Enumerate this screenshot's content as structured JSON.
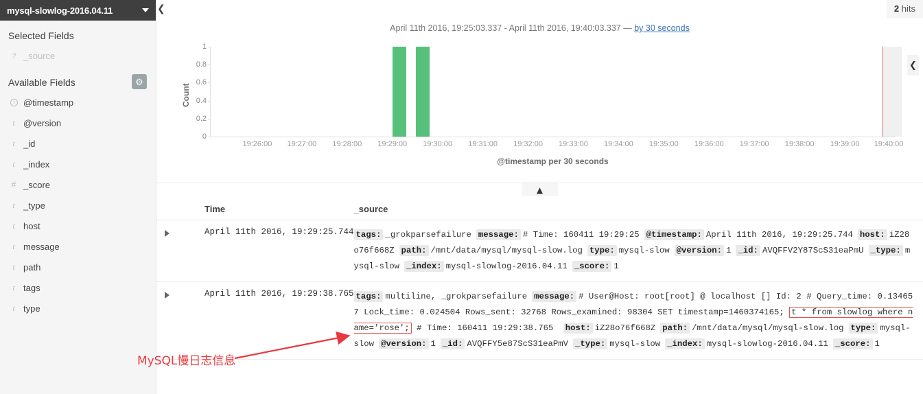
{
  "sidebar": {
    "index_pattern": "mysql-slowlog-2016.04.11",
    "caret_icon": "caret-down-icon",
    "collapse_icon": "chevron-left-icon",
    "gear_icon": "gear-icon",
    "selected_fields_title": "Selected Fields",
    "selected_fields": [
      {
        "type": "?",
        "name": "_source"
      }
    ],
    "available_fields_title": "Available Fields",
    "available_fields": [
      {
        "type": "clock",
        "name": "@timestamp"
      },
      {
        "type": "t",
        "name": "@version"
      },
      {
        "type": "t",
        "name": "_id"
      },
      {
        "type": "t",
        "name": "_index"
      },
      {
        "type": "#",
        "name": "_score"
      },
      {
        "type": "t",
        "name": "_type"
      },
      {
        "type": "t",
        "name": "host"
      },
      {
        "type": "t",
        "name": "message"
      },
      {
        "type": "t",
        "name": "path"
      },
      {
        "type": "t",
        "name": "tags"
      },
      {
        "type": "t",
        "name": "type"
      }
    ]
  },
  "header": {
    "hits_count": "2",
    "hits_label": "hits"
  },
  "chart_data": {
    "type": "bar",
    "title": "April 11th 2016, 19:25:03.337 - April 11th 2016, 19:40:03.337 — ",
    "interval_link": "by 30 seconds",
    "range_start": "April 11th 2016, 19:25:03.337",
    "range_end": "April 11th 2016, 19:40:03.337",
    "xlabel": "@timestamp per 30 seconds",
    "ylabel": "Count",
    "ylim": [
      0,
      1
    ],
    "yticks": [
      "0",
      "0.2",
      "0.4",
      "0.6",
      "0.8",
      "1"
    ],
    "xticks": [
      "19:26:00",
      "19:27:00",
      "19:28:00",
      "19:29:00",
      "19:30:00",
      "19:31:00",
      "19:32:00",
      "19:33:00",
      "19:34:00",
      "19:35:00",
      "19:36:00",
      "19:37:00",
      "19:38:00",
      "19:39:00",
      "19:40:00"
    ],
    "categories": [
      "19:29:00",
      "19:29:30"
    ],
    "values": [
      1,
      1
    ],
    "bar_color": "#57c17b",
    "grid": false,
    "legend": "none",
    "now_marker": "19:40:00",
    "collapse_icon": "chevron-left-icon"
  },
  "table": {
    "collapse_icon": "chevron-up-icon",
    "columns": [
      "Time",
      "_source"
    ],
    "expand_icon": "triangle-right-icon",
    "rows": [
      {
        "time": "April 11th 2016, 19:29:25.744",
        "fields": [
          {
            "key": "tags:",
            "value": "_grokparsefailure"
          },
          {
            "key": "message:",
            "value": "# Time: 160411 19:29:25"
          },
          {
            "key": "@timestamp:",
            "value": "April 11th 2016, 19:29:25.744"
          },
          {
            "key": "host:",
            "value": "iZ28o76f668Z"
          },
          {
            "key": "path:",
            "value": "/mnt/data/mysql/mysql-slow.log"
          },
          {
            "key": "type:",
            "value": "mysql-slow"
          },
          {
            "key": "@version:",
            "value": "1"
          },
          {
            "key": "_id:",
            "value": "AVQFFV2Y87ScS31eaPmU"
          },
          {
            "key": "_type:",
            "value": "mysql-slow"
          },
          {
            "key": "_index:",
            "value": "mysql-slowlog-2016.04.11"
          },
          {
            "key": "_score:",
            "value": "1"
          }
        ]
      },
      {
        "time": "April 11th 2016, 19:29:38.765",
        "fields": [
          {
            "key": "tags:",
            "value": "multiline, _grokparsefailure"
          },
          {
            "key": "message:",
            "value": "# User@Host: root[root] @ localhost [] Id: 2 # Query_time: 0.134657 Lock_time: 0.024504 Rows_sent: 32768 Rows_examined: 98304 SET timestamp=1460374165; select * from slowlog where name='rose'; # Time: 160411 19:29:38.765"
          },
          {
            "key": "host:",
            "value": "iZ28o76f668Z"
          },
          {
            "key": "path:",
            "value": "/mnt/data/mysql/mysql-slow.log"
          },
          {
            "key": "type:",
            "value": "mysql-slow"
          },
          {
            "key": "@version:",
            "value": "1"
          },
          {
            "key": "_id:",
            "value": "AVQFFY5e87ScS31eaPmV"
          },
          {
            "key": "_type:",
            "value": "mysql-slow"
          },
          {
            "key": "_index:",
            "value": "mysql-slowlog-2016.04.11"
          },
          {
            "key": "_score:",
            "value": "1"
          }
        ],
        "highlight": "t * from slowlog where name='rose';"
      }
    ]
  },
  "annotation": {
    "text": "MySQL慢日志信息",
    "color": "#e8393f"
  }
}
